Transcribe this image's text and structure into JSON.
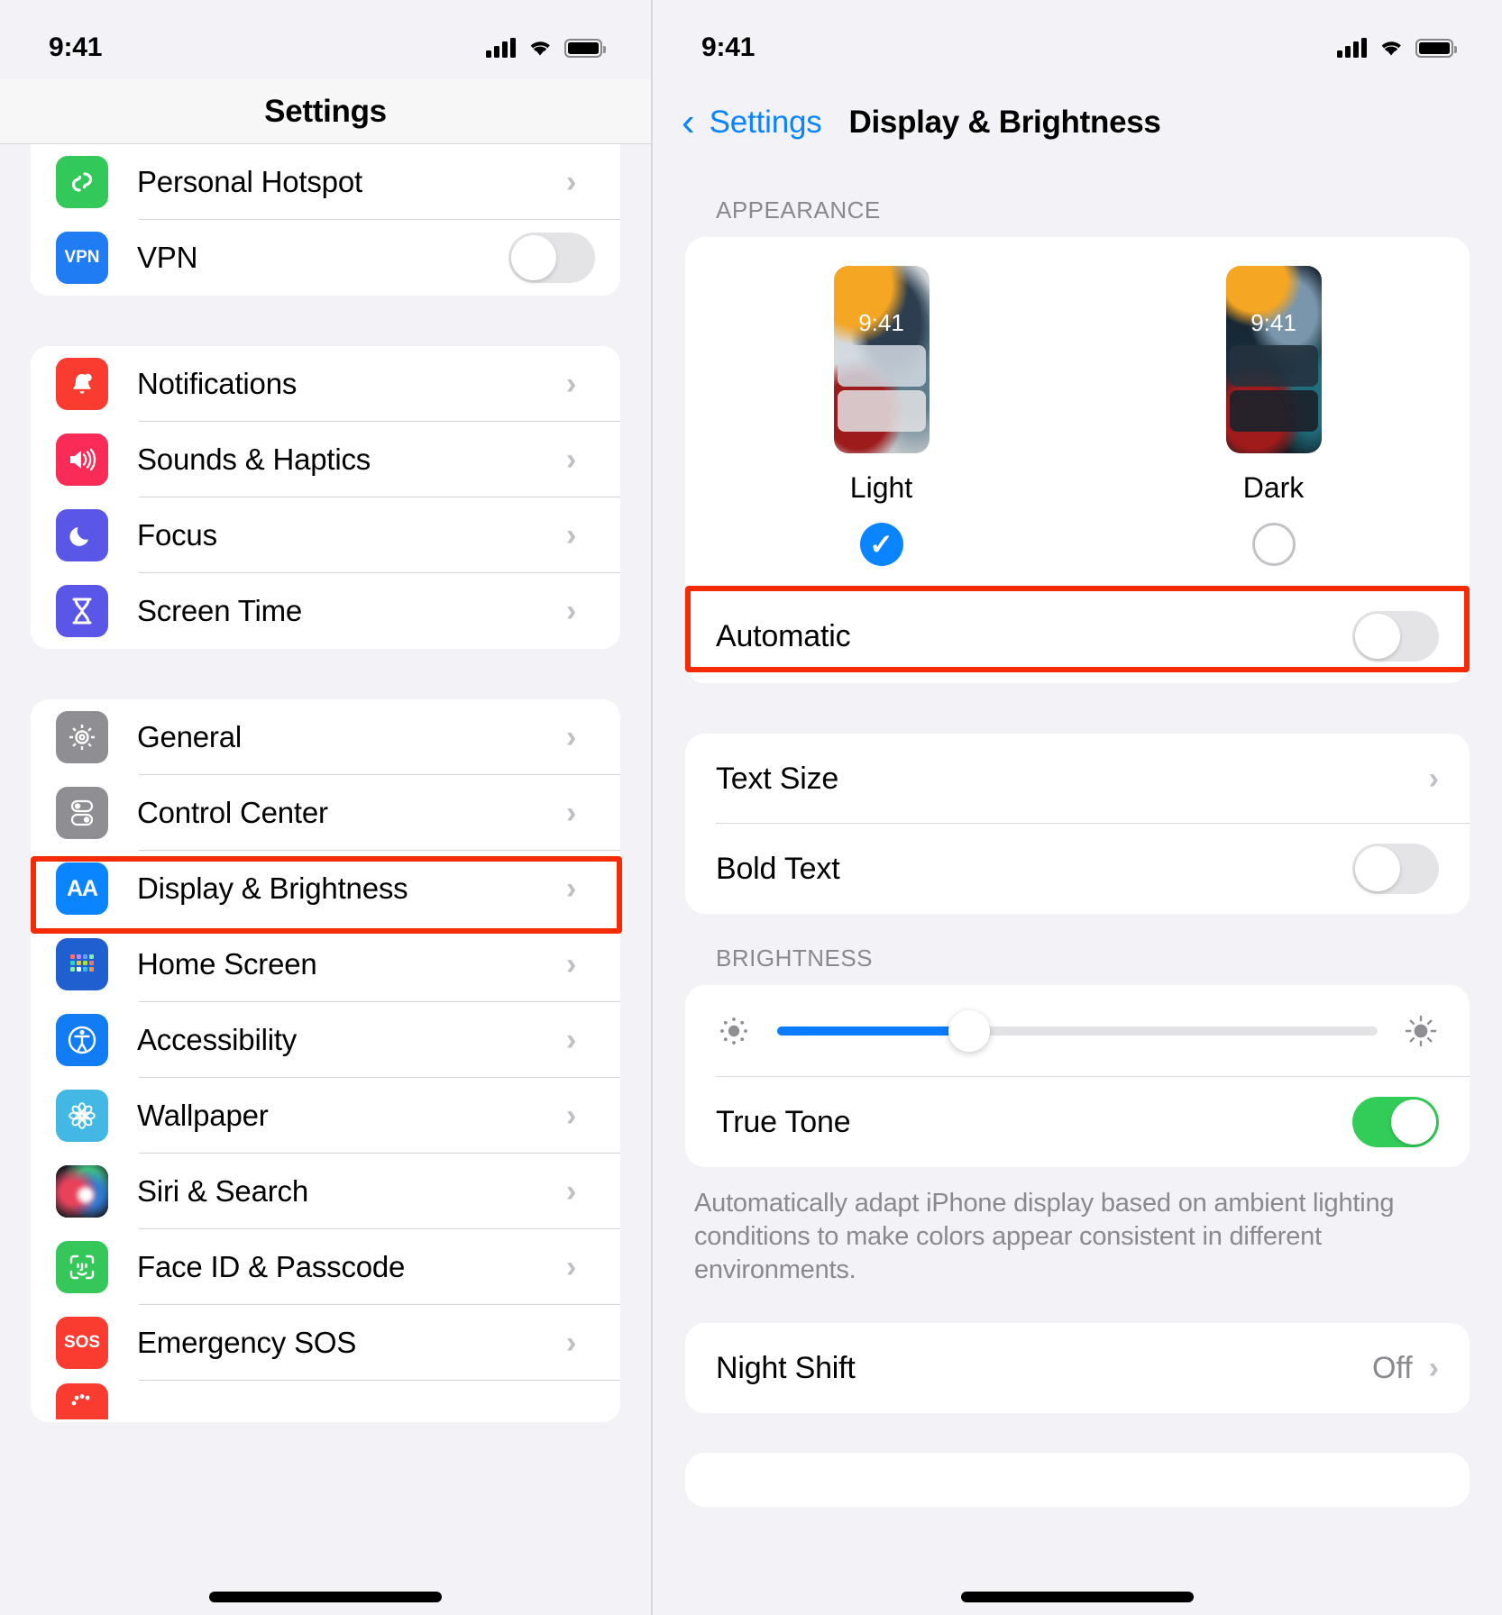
{
  "status_bar": {
    "time": "9:41"
  },
  "left_screen": {
    "nav_title": "Settings",
    "groups": [
      {
        "items": [
          {
            "label": "Personal Hotspot",
            "icon": "personal-hotspot-icon",
            "accessory": "chevron",
            "icon_bg": "#32C85A"
          },
          {
            "label": "VPN",
            "icon": "vpn-icon",
            "accessory": "toggle-off",
            "icon_bg": "#1F7CF2",
            "icon_text": "VPN"
          }
        ]
      },
      {
        "items": [
          {
            "label": "Notifications",
            "icon": "bell-icon",
            "accessory": "chevron",
            "icon_bg": "#FA3C30"
          },
          {
            "label": "Sounds & Haptics",
            "icon": "speaker-icon",
            "accessory": "chevron",
            "icon_bg": "#FA2B56"
          },
          {
            "label": "Focus",
            "icon": "moon-icon",
            "accessory": "chevron",
            "icon_bg": "#5A56E8"
          },
          {
            "label": "Screen Time",
            "icon": "hourglass-icon",
            "accessory": "chevron",
            "icon_bg": "#5A56E8"
          }
        ]
      },
      {
        "items": [
          {
            "label": "General",
            "icon": "gear-icon",
            "accessory": "chevron",
            "icon_bg": "#8E8E93"
          },
          {
            "label": "Control Center",
            "icon": "control-center-icon",
            "accessory": "chevron",
            "icon_bg": "#8E8E93"
          },
          {
            "label": "Display & Brightness",
            "icon": "display-brightness-icon",
            "accessory": "chevron",
            "icon_bg": "#0A84FF",
            "icon_text": "AA",
            "highlighted": true
          },
          {
            "label": "Home Screen",
            "icon": "home-screen-icon",
            "accessory": "chevron",
            "icon_bg": "#1F5FD0"
          },
          {
            "label": "Accessibility",
            "icon": "accessibility-icon",
            "accessory": "chevron",
            "icon_bg": "#127CF5"
          },
          {
            "label": "Wallpaper",
            "icon": "wallpaper-icon",
            "accessory": "chevron",
            "icon_bg": "#43B8E4"
          },
          {
            "label": "Siri & Search",
            "icon": "siri-icon",
            "accessory": "chevron",
            "icon_bg": "#1A1A22"
          },
          {
            "label": "Face ID & Passcode",
            "icon": "face-id-icon",
            "accessory": "chevron",
            "icon_bg": "#35C759"
          },
          {
            "label": "Emergency SOS",
            "icon": "sos-icon",
            "accessory": "chevron",
            "icon_bg": "#FA3C30",
            "icon_text": "SOS"
          }
        ]
      }
    ]
  },
  "right_screen": {
    "back_label": "Settings",
    "nav_title": "Display & Brightness",
    "appearance": {
      "header": "APPEARANCE",
      "options": [
        {
          "label": "Light",
          "preview_time": "9:41",
          "selected": true
        },
        {
          "label": "Dark",
          "preview_time": "9:41",
          "selected": false
        }
      ],
      "automatic": {
        "label": "Automatic",
        "state": "off",
        "highlighted": true
      }
    },
    "text_group": [
      {
        "label": "Text Size",
        "accessory": "chevron"
      },
      {
        "label": "Bold Text",
        "accessory": "toggle-off"
      }
    ],
    "brightness": {
      "header": "BRIGHTNESS",
      "slider": {
        "value_percent": 32,
        "low_icon": "brightness-low-icon",
        "high_icon": "brightness-high-icon"
      },
      "true_tone": {
        "label": "True Tone",
        "state": "on"
      },
      "footnote": "Automatically adapt iPhone display based on ambient lighting conditions to make colors appear consistent in different environments."
    },
    "night_shift": {
      "label": "Night Shift",
      "value": "Off",
      "accessory": "chevron"
    }
  },
  "colors": {
    "accent_blue": "#0A84FF",
    "highlight_red": "#F52B06",
    "toggle_green": "#32CD58",
    "background_gray": "#F2F2F7"
  }
}
